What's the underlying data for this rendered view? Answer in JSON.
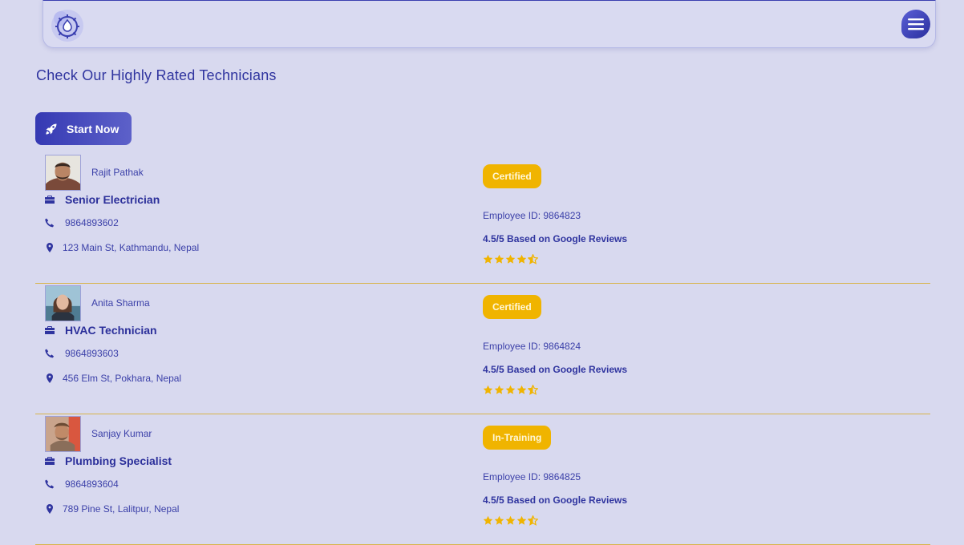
{
  "header": {
    "logo_icon": "gear-flame-logo",
    "menu_icon": "hamburger-menu-icon"
  },
  "page": {
    "title": "Check Our Highly Rated Technicians",
    "start_button_label": "Start Now",
    "start_button_icon": "rocket-icon"
  },
  "colors": {
    "background": "#d8d9ef",
    "primary": "#2b2f9a",
    "badge": "#f0b400",
    "star": "#f0b400",
    "divider": "#d8b44a"
  },
  "technicians": [
    {
      "name": "Rajit Pathak",
      "role": "Senior Electrician",
      "phone": "9864893602",
      "address": "123 Main St, Kathmandu, Nepal",
      "status": "Certified",
      "employee_id": "Employee ID: 9864823",
      "reviews": "4.5/5 Based on Google Reviews",
      "rating": 4.5
    },
    {
      "name": "Anita Sharma",
      "role": "HVAC Technician",
      "phone": "9864893603",
      "address": "456 Elm St, Pokhara, Nepal",
      "status": "Certified",
      "employee_id": "Employee ID: 9864824",
      "reviews": "4.5/5 Based on Google Reviews",
      "rating": 4.5
    },
    {
      "name": "Sanjay Kumar",
      "role": "Plumbing Specialist",
      "phone": "9864893604",
      "address": "789 Pine St, Lalitpur, Nepal",
      "status": "In-Training",
      "employee_id": "Employee ID: 9864825",
      "reviews": "4.5/5 Based on Google Reviews",
      "rating": 4.5
    }
  ]
}
